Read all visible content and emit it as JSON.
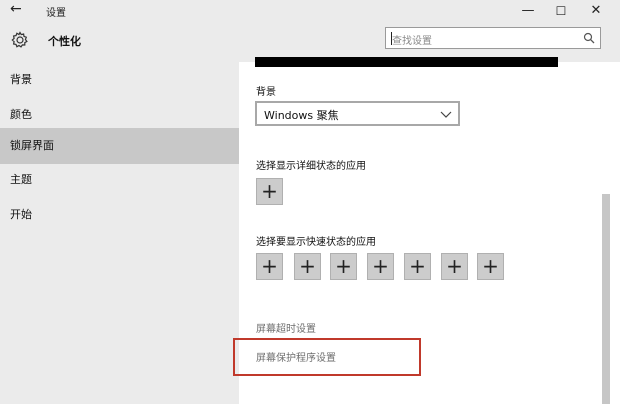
{
  "window": {
    "back_glyph": "←",
    "title": "设置",
    "minimize_glyph": "—",
    "maximize_glyph": "☐",
    "close_glyph": "✕"
  },
  "app": {
    "title": "个性化",
    "icon": "gear-icon"
  },
  "sidebar": {
    "items": [
      {
        "label": "背景",
        "active": false
      },
      {
        "label": "颜色",
        "active": false
      },
      {
        "label": "锁屏界面",
        "active": true
      },
      {
        "label": "主题",
        "active": false
      },
      {
        "label": "开始",
        "active": false
      }
    ]
  },
  "search": {
    "placeholder": "查找设置",
    "icon": "search-icon"
  },
  "main": {
    "background_label": "背景",
    "background_value": "Windows 聚焦",
    "detailed_status_label": "选择显示详细状态的应用",
    "quick_status_label": "选择要显示快速状态的应用",
    "plus_glyph": "+",
    "screen_timeout_link": "屏幕超时设置",
    "screen_saver_link": "屏幕保护程序设置"
  },
  "colors": {
    "sidebar_bg": "#ebebeb",
    "active_item_bg": "#c8c8c8",
    "highlight_box": "#c0392b"
  }
}
